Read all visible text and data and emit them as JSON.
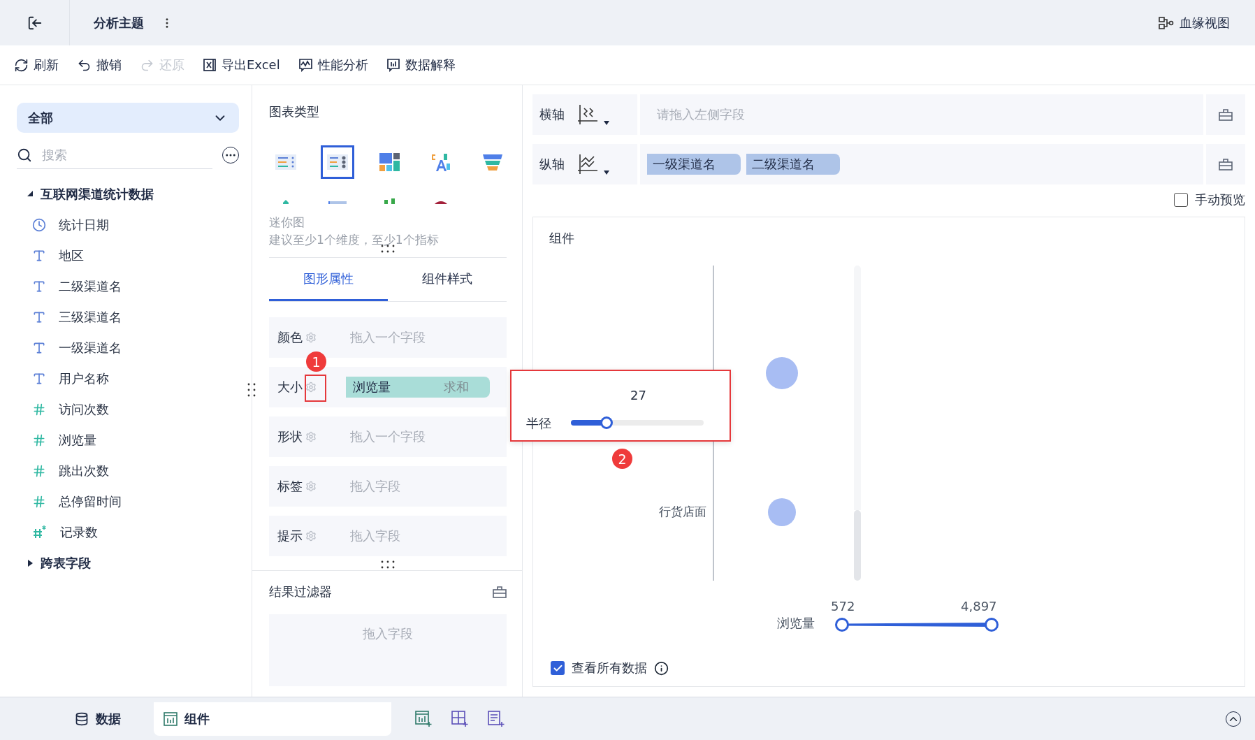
{
  "header": {
    "title": "分析主题",
    "lineage": "血缘视图"
  },
  "toolbar": [
    {
      "kind": "refresh",
      "label": "刷新",
      "disabled": false
    },
    {
      "kind": "undo",
      "label": "撤销",
      "disabled": false
    },
    {
      "kind": "redo",
      "label": "还原",
      "disabled": true
    },
    {
      "kind": "export",
      "label": "导出Excel",
      "disabled": false
    },
    {
      "kind": "performance",
      "label": "性能分析",
      "disabled": false
    },
    {
      "kind": "explain",
      "label": "数据解释",
      "disabled": false
    }
  ],
  "fields_panel": {
    "scope": "全部",
    "search": {
      "placeholder": "搜索"
    },
    "tables": [
      {
        "name": "互联网渠道统计数据",
        "expanded": true,
        "children": [
          {
            "kind": "date",
            "name": "统计日期"
          },
          {
            "kind": "text",
            "name": "地区"
          },
          {
            "kind": "text",
            "name": "二级渠道名"
          },
          {
            "kind": "text",
            "name": "三级渠道名"
          },
          {
            "kind": "text",
            "name": "一级渠道名"
          },
          {
            "kind": "text",
            "name": "用户名称"
          },
          {
            "kind": "number",
            "name": "访问次数"
          },
          {
            "kind": "number",
            "name": "浏览量"
          },
          {
            "kind": "number",
            "name": "跳出次数"
          },
          {
            "kind": "number",
            "name": "总停留时间"
          },
          {
            "kind": "calculated",
            "name": "记录数"
          }
        ]
      },
      {
        "name": "跨表字段",
        "expanded": false
      }
    ]
  },
  "chart_panel": {
    "title": "图表类型",
    "chart_types": [
      {
        "kind": "ranked-list",
        "selected": false
      },
      {
        "kind": "detail-list",
        "selected": true
      },
      {
        "kind": "treemap",
        "selected": false
      },
      {
        "kind": "word-cloud",
        "selected": false
      },
      {
        "kind": "funnel",
        "selected": false
      },
      {
        "kind": "map",
        "selected": false
      },
      {
        "kind": "range-bar",
        "selected": false
      },
      {
        "kind": "candlestick",
        "selected": false
      },
      {
        "kind": "gauge",
        "selected": false
      }
    ],
    "type_name": "迷你图",
    "hint": "建议至少1个维度，至少1个指标",
    "tabs": [
      {
        "label": "图形属性",
        "selected": true
      },
      {
        "label": "组件样式",
        "selected": false
      }
    ],
    "properties": [
      {
        "label": "颜色",
        "placeholder": "拖入一个字段"
      },
      {
        "label": "大小",
        "field": {
          "name": "浏览量",
          "aggregation": "求和"
        },
        "callout": "1"
      },
      {
        "label": "形状",
        "placeholder": "拖入一个字段"
      },
      {
        "label": "标签",
        "placeholder": "拖入字段"
      },
      {
        "label": "提示",
        "placeholder": "拖入字段"
      }
    ],
    "filter": {
      "title": "结果过滤器",
      "placeholder": "拖入字段"
    }
  },
  "axes": [
    {
      "label": "横轴",
      "kind": "x",
      "placeholder": "请拖入左侧字段"
    },
    {
      "label": "纵轴",
      "kind": "y",
      "fields": [
        "一级渠道名",
        "二级渠道名"
      ]
    }
  ],
  "manual_preview": {
    "label": "手动预览",
    "checked": false
  },
  "widget": {
    "title": "组件",
    "category_label": "行货店面",
    "size_legend": {
      "label": "浏览量",
      "min": "572",
      "max": "4,897"
    },
    "view_all": {
      "label": "查看所有数据",
      "checked": true
    }
  },
  "radius_popover": {
    "value": "27",
    "label": "半径",
    "level": 0.27,
    "callout": "2"
  },
  "bottom_tabs": [
    {
      "kind": "data",
      "label": "数据",
      "selected": false
    },
    {
      "kind": "widget",
      "label": "组件",
      "selected": true
    }
  ],
  "bottom_actions": [
    {
      "kind": "add-chart"
    },
    {
      "kind": "add-dashboard"
    },
    {
      "kind": "add-report"
    }
  ]
}
